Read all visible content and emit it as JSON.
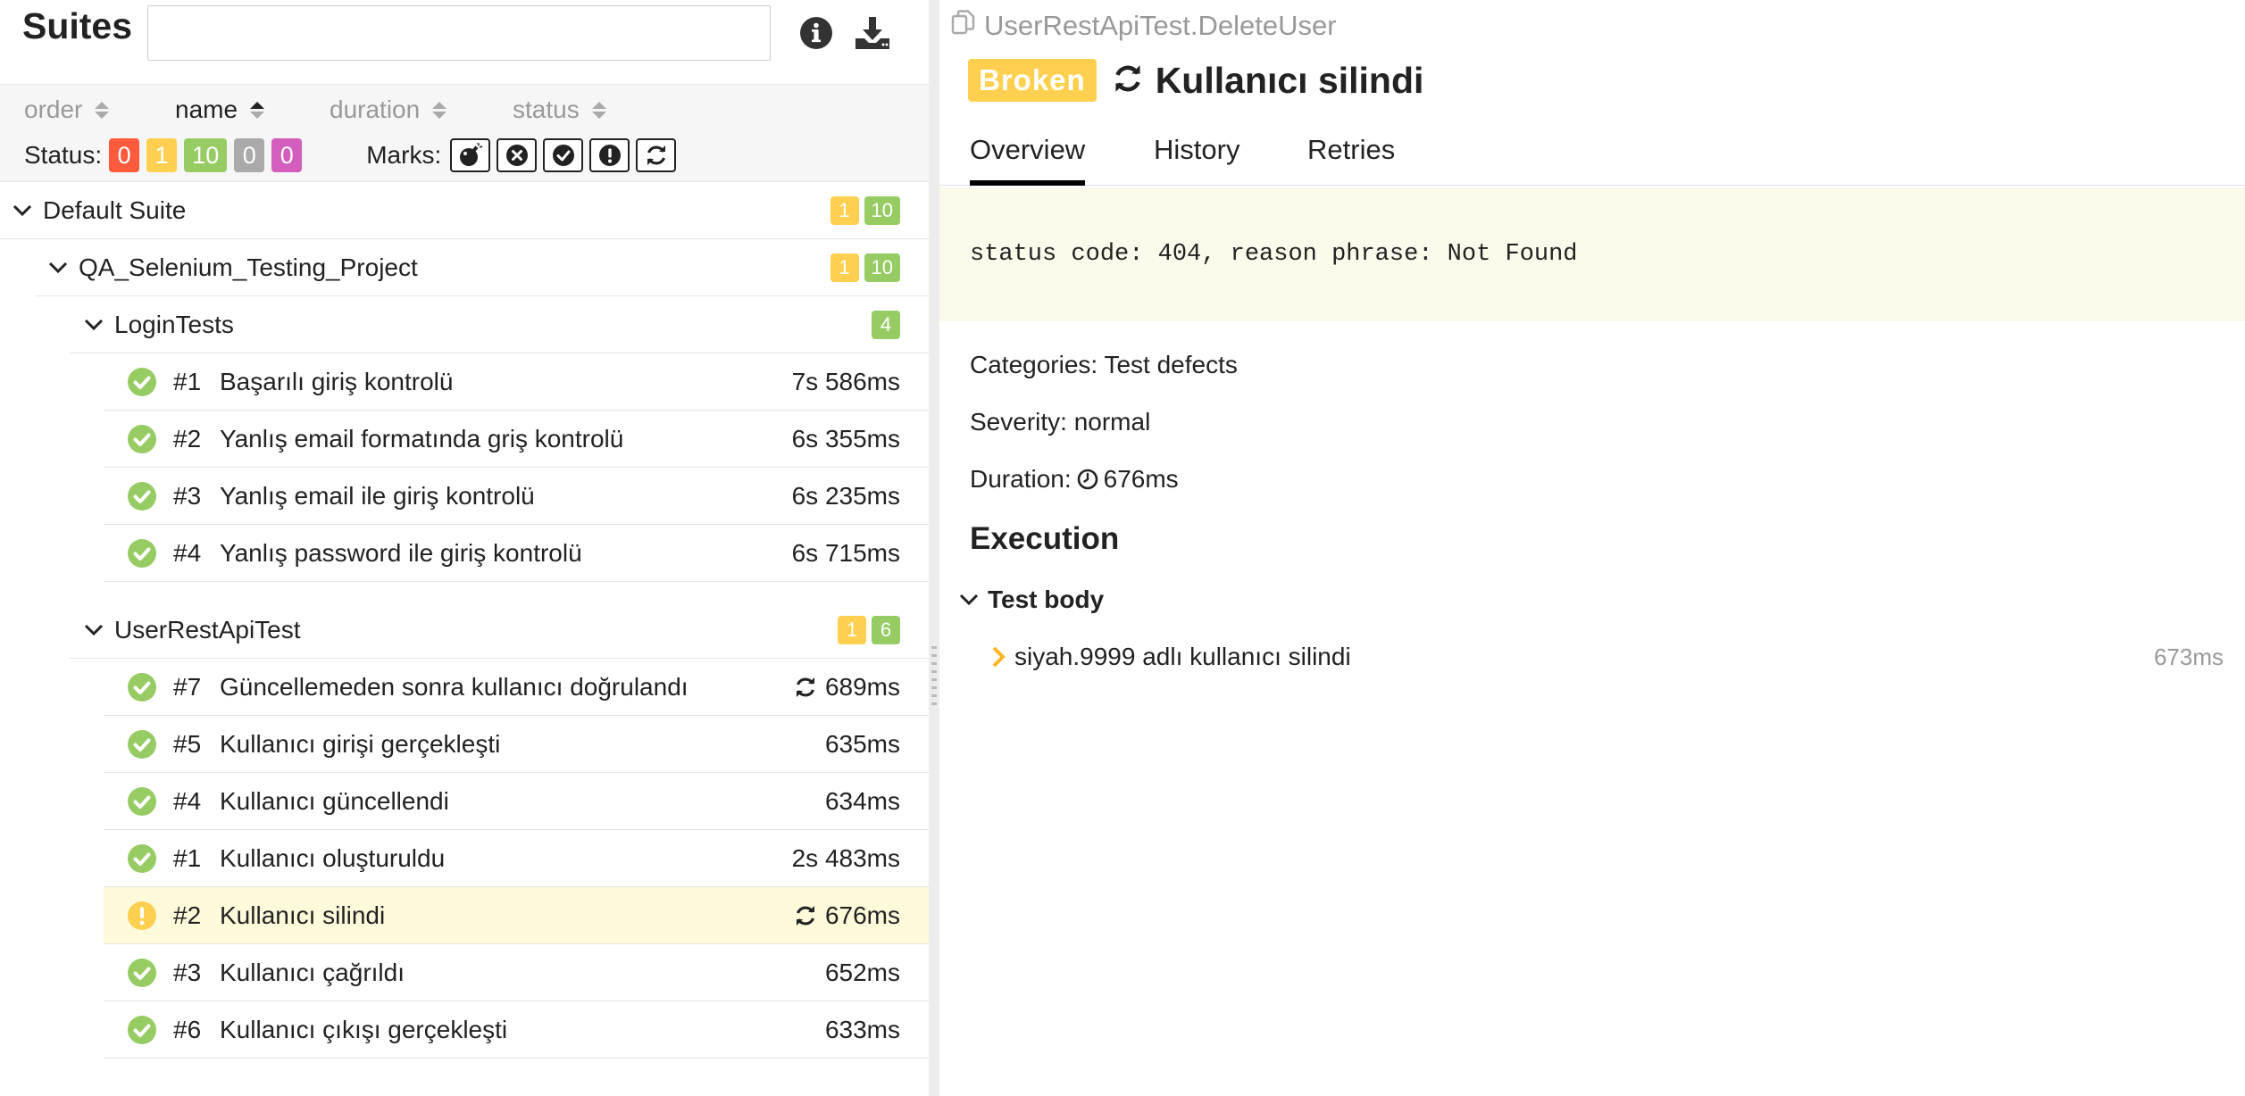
{
  "left": {
    "title": "Suites",
    "search": {
      "placeholder": ""
    },
    "sort": {
      "order": "order",
      "name": "name",
      "duration": "duration",
      "status": "status"
    },
    "status_label": "Status:",
    "status_counts": {
      "failed": "0",
      "broken": "1",
      "passed": "10",
      "skipped": "0",
      "unknown": "0"
    },
    "marks_label": "Marks:",
    "tree": {
      "default_suite": {
        "label": "Default Suite",
        "broken": "1",
        "passed": "10"
      },
      "project": {
        "label": "QA_Selenium_Testing_Project",
        "broken": "1",
        "passed": "10"
      },
      "login": {
        "label": "LoginTests",
        "passed": "4",
        "tests": [
          {
            "num": "#1",
            "name": "Başarılı giriş kontrolü",
            "duration": "7s 586ms",
            "status": "passed",
            "retried": false
          },
          {
            "num": "#2",
            "name": "Yanlış email formatında griş kontrolü",
            "duration": "6s 355ms",
            "status": "passed",
            "retried": false
          },
          {
            "num": "#3",
            "name": "Yanlış email ile giriş kontrolü",
            "duration": "6s 235ms",
            "status": "passed",
            "retried": false
          },
          {
            "num": "#4",
            "name": "Yanlış password ile giriş kontrolü",
            "duration": "6s 715ms",
            "status": "passed",
            "retried": false
          }
        ]
      },
      "api": {
        "label": "UserRestApiTest",
        "broken": "1",
        "passed": "6",
        "tests": [
          {
            "num": "#7",
            "name": "Güncellemeden sonra kullanıcı doğrulandı",
            "duration": "689ms",
            "status": "passed",
            "retried": true
          },
          {
            "num": "#5",
            "name": "Kullanıcı girişi gerçekleşti",
            "duration": "635ms",
            "status": "passed",
            "retried": false
          },
          {
            "num": "#4",
            "name": "Kullanıcı güncellendi",
            "duration": "634ms",
            "status": "passed",
            "retried": false
          },
          {
            "num": "#1",
            "name": "Kullanıcı oluşturuldu",
            "duration": "2s 483ms",
            "status": "passed",
            "retried": false
          },
          {
            "num": "#2",
            "name": "Kullanıcı silindi",
            "duration": "676ms",
            "status": "broken",
            "retried": true,
            "selected": true
          },
          {
            "num": "#3",
            "name": "Kullanıcı çağrıldı",
            "duration": "652ms",
            "status": "passed",
            "retried": false
          },
          {
            "num": "#6",
            "name": "Kullanıcı çıkışı gerçekleşti",
            "duration": "633ms",
            "status": "passed",
            "retried": false
          }
        ]
      }
    }
  },
  "right": {
    "breadcrumb": "UserRestApiTest.DeleteUser",
    "status_badge": "Broken",
    "title": "Kullanıcı silindi",
    "tabs": [
      "Overview",
      "History",
      "Retries"
    ],
    "error_message": "status code: 404, reason phrase: Not Found",
    "categories": "Categories: Test defects",
    "severity": "Severity: normal",
    "duration_label": "Duration:",
    "duration_value": "676ms",
    "execution_heading": "Execution",
    "test_body_label": "Test body",
    "steps": [
      {
        "name": "siyah.9999 adlı kullanıcı silindi",
        "duration": "673ms"
      }
    ]
  },
  "colors": {
    "failed": "#fd5a3e",
    "broken": "#ffd050",
    "passed": "#97cc64",
    "skipped": "#aaaaaa",
    "unknown": "#d35ebe",
    "selected_row": "#fffad9",
    "error_bg": "#fcfaeb"
  },
  "icons": {
    "info": "info-icon",
    "download": "download-icon",
    "marks": [
      "bomb-icon",
      "times-circle-icon",
      "check-circle-icon",
      "exclamation-circle-icon",
      "refresh-icon"
    ],
    "status_passed": "check-circle-icon",
    "status_broken": "exclamation-circle-icon",
    "retried": "refresh-icon",
    "clock": "clock-icon",
    "copy": "copy-icon"
  }
}
